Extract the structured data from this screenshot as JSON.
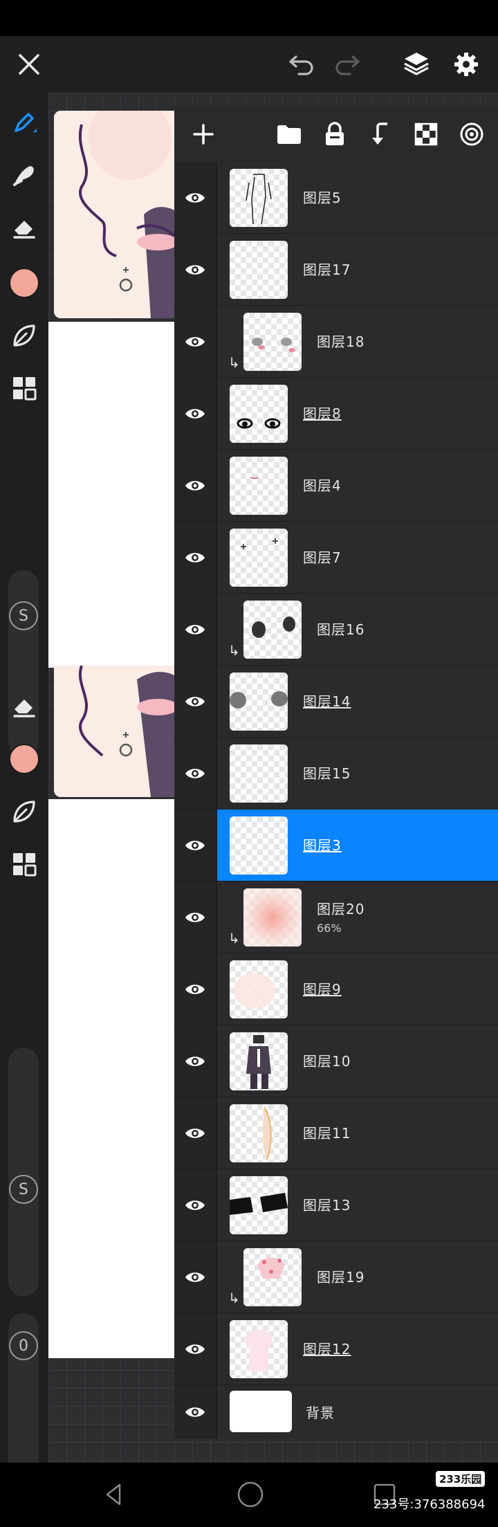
{
  "top_bar": {
    "icons": [
      "close-icon",
      "undo-icon",
      "redo-icon",
      "layers-icon",
      "settings-icon"
    ]
  },
  "left_toolbar": {
    "icons": [
      "pen-icon",
      "smudge-icon",
      "eraser-icon",
      "color-swatch",
      "leaf-icon",
      "grid-icon"
    ],
    "color": "#f2a79a",
    "size_indicator": "S",
    "opacity_indicator": "0"
  },
  "layer_toolbar": {
    "icons": [
      "add-icon",
      "folder-icon",
      "lock-icon",
      "merge-down-icon",
      "checker-icon",
      "target-icon"
    ]
  },
  "layers": [
    {
      "name": "图层5",
      "underline": false,
      "clipped": false,
      "opacity": ""
    },
    {
      "name": "图层17",
      "underline": false,
      "clipped": false,
      "opacity": ""
    },
    {
      "name": "图层18",
      "underline": false,
      "clipped": true,
      "opacity": ""
    },
    {
      "name": "图层8",
      "underline": true,
      "clipped": false,
      "opacity": ""
    },
    {
      "name": "图层4",
      "underline": false,
      "clipped": false,
      "opacity": ""
    },
    {
      "name": "图层7",
      "underline": false,
      "clipped": false,
      "opacity": ""
    },
    {
      "name": "图层16",
      "underline": false,
      "clipped": true,
      "opacity": ""
    },
    {
      "name": "图层14",
      "underline": true,
      "clipped": false,
      "opacity": ""
    },
    {
      "name": "图层15",
      "underline": false,
      "clipped": false,
      "opacity": ""
    },
    {
      "name": "图层3",
      "underline": true,
      "clipped": false,
      "opacity": "",
      "selected": true
    },
    {
      "name": "图层20",
      "underline": false,
      "clipped": true,
      "opacity": "66%"
    },
    {
      "name": "图层9",
      "underline": true,
      "clipped": false,
      "opacity": ""
    },
    {
      "name": "图层10",
      "underline": false,
      "clipped": false,
      "opacity": ""
    },
    {
      "name": "图层11",
      "underline": false,
      "clipped": false,
      "opacity": ""
    },
    {
      "name": "图层13",
      "underline": false,
      "clipped": false,
      "opacity": ""
    },
    {
      "name": "图层19",
      "underline": false,
      "clipped": true,
      "opacity": ""
    },
    {
      "name": "图层12",
      "underline": true,
      "clipped": false,
      "opacity": ""
    },
    {
      "name": "背景",
      "underline": false,
      "clipped": false,
      "opacity": ""
    }
  ],
  "bottom_nav": {
    "icons": [
      "back-icon",
      "home-icon",
      "recents-icon"
    ],
    "watermark_brand": "233乐园",
    "watermark_id": "233号:376388694"
  },
  "colors": {
    "accent": "#0a84ff",
    "brush_color": "#f2a79a"
  }
}
